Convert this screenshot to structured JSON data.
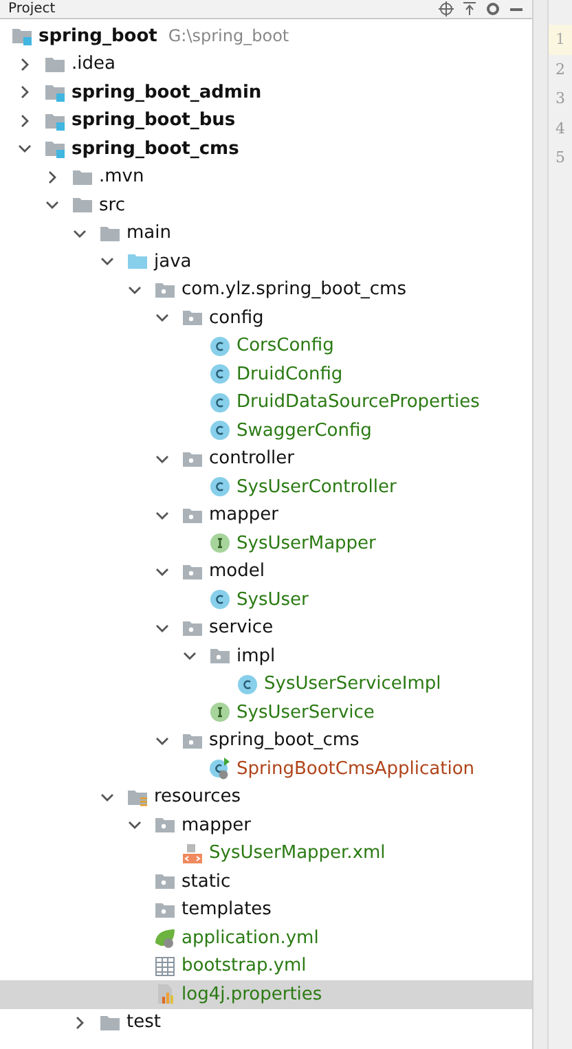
{
  "panel": {
    "title": "Project"
  },
  "tree": [
    {
      "kind": "module",
      "name": "spring_boot",
      "path": "G:\\spring_boot",
      "selected": false,
      "children": [
        {
          "kind": "folder",
          "name": ".idea",
          "expanded": false,
          "selected": false
        },
        {
          "kind": "module",
          "name": "spring_boot_admin",
          "expanded": false,
          "selected": false
        },
        {
          "kind": "module",
          "name": "spring_boot_bus",
          "expanded": false,
          "selected": false
        },
        {
          "kind": "module",
          "name": "spring_boot_cms",
          "expanded": true,
          "selected": false,
          "children": [
            {
              "kind": "folder",
              "name": ".mvn",
              "expanded": false,
              "selected": false
            },
            {
              "kind": "folder",
              "name": "src",
              "expanded": true,
              "selected": false,
              "children": [
                {
                  "kind": "folder",
                  "name": "main",
                  "expanded": true,
                  "selected": false,
                  "children": [
                    {
                      "kind": "source-root",
                      "name": "java",
                      "expanded": true,
                      "selected": false,
                      "children": [
                        {
                          "kind": "package",
                          "name": "com.ylz.spring_boot_cms",
                          "expanded": true,
                          "selected": false,
                          "children": [
                            {
                              "kind": "package",
                              "name": "config",
                              "expanded": true,
                              "selected": false,
                              "children": [
                                {
                                  "kind": "class",
                                  "name": "CorsConfig",
                                  "color": "#2a7a12",
                                  "selected": false
                                },
                                {
                                  "kind": "class",
                                  "name": "DruidConfig",
                                  "color": "#2a7a12",
                                  "selected": false
                                },
                                {
                                  "kind": "class",
                                  "name": "DruidDataSourceProperties",
                                  "color": "#2a7a12",
                                  "selected": false
                                },
                                {
                                  "kind": "class",
                                  "name": "SwaggerConfig",
                                  "color": "#2a7a12",
                                  "selected": false
                                }
                              ]
                            },
                            {
                              "kind": "package",
                              "name": "controller",
                              "expanded": true,
                              "selected": false,
                              "children": [
                                {
                                  "kind": "class",
                                  "name": "SysUserController",
                                  "color": "#2a7a12",
                                  "selected": false
                                }
                              ]
                            },
                            {
                              "kind": "package",
                              "name": "mapper",
                              "expanded": true,
                              "selected": false,
                              "children": [
                                {
                                  "kind": "interface",
                                  "name": "SysUserMapper",
                                  "color": "#2a7a12",
                                  "selected": false
                                }
                              ]
                            },
                            {
                              "kind": "package",
                              "name": "model",
                              "expanded": true,
                              "selected": false,
                              "children": [
                                {
                                  "kind": "class",
                                  "name": "SysUser",
                                  "color": "#2a7a12",
                                  "selected": false
                                }
                              ]
                            },
                            {
                              "kind": "package",
                              "name": "service",
                              "expanded": true,
                              "selected": false,
                              "children": [
                                {
                                  "kind": "package",
                                  "name": "impl",
                                  "expanded": true,
                                  "selected": false,
                                  "children": [
                                    {
                                      "kind": "class",
                                      "name": "SysUserServiceImpl",
                                      "color": "#2a7a12",
                                      "selected": false
                                    }
                                  ]
                                },
                                {
                                  "kind": "interface",
                                  "name": "SysUserService",
                                  "color": "#2a7a12",
                                  "selected": false
                                }
                              ]
                            },
                            {
                              "kind": "package",
                              "name": "spring_boot_cms",
                              "expanded": true,
                              "selected": false,
                              "children": [
                                {
                                  "kind": "app-class",
                                  "name": "SpringBootCmsApplication",
                                  "color": "#b0441a",
                                  "selected": false
                                }
                              ]
                            }
                          ]
                        }
                      ]
                    },
                    {
                      "kind": "resources",
                      "name": "resources",
                      "expanded": true,
                      "selected": false,
                      "children": [
                        {
                          "kind": "package",
                          "name": "mapper",
                          "expanded": true,
                          "selected": false,
                          "children": [
                            {
                              "kind": "xml",
                              "name": "SysUserMapper.xml",
                              "color": "#2a7a12",
                              "selected": false
                            }
                          ]
                        },
                        {
                          "kind": "package",
                          "name": "static",
                          "selected": false
                        },
                        {
                          "kind": "package",
                          "name": "templates",
                          "selected": false
                        },
                        {
                          "kind": "spring-yml",
                          "name": "application.yml",
                          "color": "#2a7a12",
                          "selected": false
                        },
                        {
                          "kind": "yml",
                          "name": "bootstrap.yml",
                          "color": "#2a7a12",
                          "selected": false
                        },
                        {
                          "kind": "properties",
                          "name": "log4j.properties",
                          "color": "#2a7a12",
                          "selected": true
                        }
                      ]
                    }
                  ]
                },
                {
                  "kind": "folder",
                  "name": "test",
                  "expanded": false,
                  "selected": false
                }
              ]
            }
          ]
        }
      ]
    }
  ],
  "gutter": {
    "lines": [
      {
        "number": "1",
        "selected": true
      },
      {
        "number": "2",
        "selected": false
      },
      {
        "number": "3",
        "selected": false
      },
      {
        "number": "4",
        "selected": false
      },
      {
        "number": "5",
        "selected": false
      }
    ]
  }
}
